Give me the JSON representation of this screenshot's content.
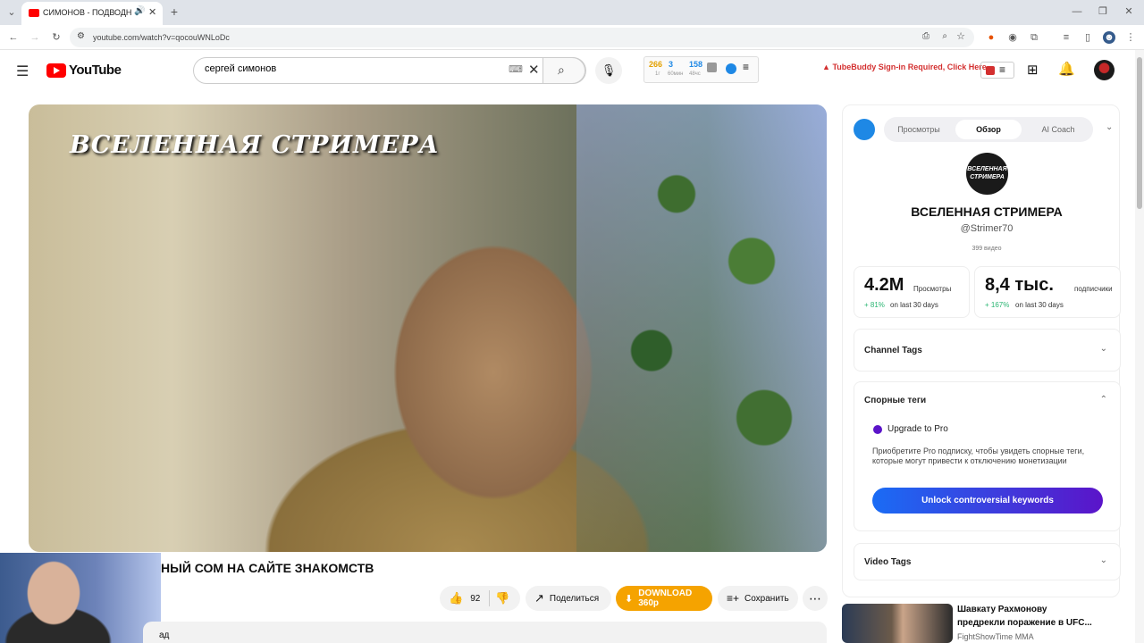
{
  "browser": {
    "tab_title": "СИМОНОВ - ПОДВОДНЫЙ",
    "url": "youtube.com/watch?v=qocouWNLoDc"
  },
  "youtube": {
    "logo_text": "YouTube",
    "search_value": "сергей симонов",
    "stats_widget": {
      "a_value": "266",
      "a_label": "1г",
      "b_value": "3",
      "b_label": "60мин",
      "c_value": "158",
      "c_label": "48чс"
    },
    "tubebuddy_alert": "TubeBuddy Sign-in Required, Click Here"
  },
  "video": {
    "overlay_title": "ВСЕЛЕННАЯ СТРИМЕРА",
    "title": "НЫЙ СОМ НА САЙТЕ ЗНАКОМСТВ",
    "likes": "92",
    "share_label": "Поделиться",
    "download_label": "DOWNLOAD 360p",
    "save_label": "Сохранить",
    "below_partial": "ад"
  },
  "panel": {
    "tabs": [
      "Просмотры",
      "Обзор",
      "AI Coach"
    ],
    "active_tab": "Обзор",
    "avatar_text": "ВСЕЛЕННАЯ СТРИМЕРА",
    "channel_name": "ВСЕЛЕННАЯ СТРИМЕРА",
    "channel_handle": "@Strimer70",
    "video_count": "399 видео",
    "views_value": "4.2M",
    "views_label": "Просмотры",
    "views_growth": "+ 81%",
    "views_period": "on last 30 days",
    "subs_value": "8,4 тыс.",
    "subs_label": "подписчики",
    "subs_growth": "+ 167%",
    "subs_period": "on last 30 days",
    "channel_tags_title": "Channel Tags",
    "controversial_title": "Спорные теги",
    "upgrade_title": "Upgrade to Pro",
    "upgrade_text": "Приобретите Pro подписку, чтобы увидеть спорные теги, которые могут привести к отключению монетизации",
    "unlock_button": "Unlock controversial keywords",
    "video_tags_title": "Video Tags"
  },
  "recommendation": {
    "title_line1": "Шавкату Рахмонову",
    "title_line2": "предрекли поражение в UFC...",
    "channel": "FightShowTime MMA"
  },
  "colors": {
    "youtube_red": "#ff0000",
    "download_orange": "#f5a300",
    "unlock_gradient_start": "#1a6cf5",
    "unlock_gradient_end": "#5b14c9",
    "growth_green": "#2bb673",
    "alert_red": "#d32f2f"
  }
}
